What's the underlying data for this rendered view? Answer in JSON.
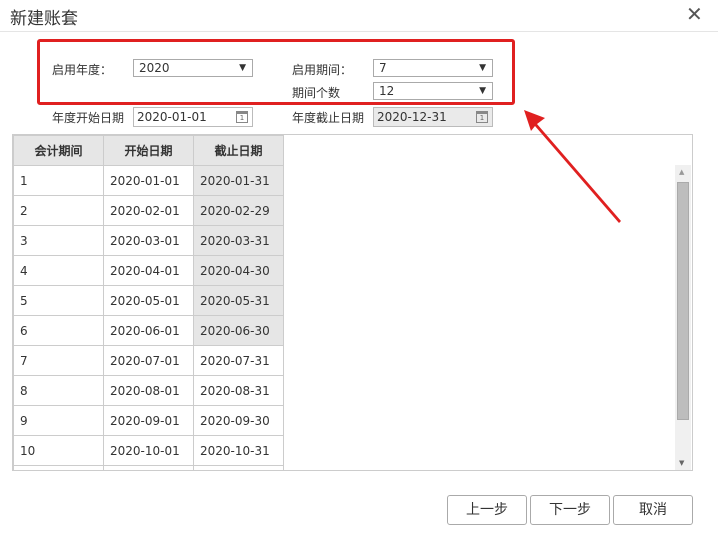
{
  "dialog": {
    "title": "新建账套",
    "close_icon": "close-icon"
  },
  "form": {
    "start_year_label": "启用年度：",
    "start_year_value": "2020",
    "start_period_label": "启用期间：",
    "start_period_value": "7",
    "period_count_label": "期间个数",
    "period_count_value": "12",
    "year_start_label": "年度开始日期",
    "year_start_value": "2020-01-01",
    "year_end_label": "年度截止日期",
    "year_end_value": "2020-12-31"
  },
  "table": {
    "headers": [
      "会计期间",
      "开始日期",
      "截止日期"
    ],
    "rows": [
      [
        "1",
        "2020-01-01",
        "2020-01-31"
      ],
      [
        "2",
        "2020-02-01",
        "2020-02-29"
      ],
      [
        "3",
        "2020-03-01",
        "2020-03-31"
      ],
      [
        "4",
        "2020-04-01",
        "2020-04-30"
      ],
      [
        "5",
        "2020-05-01",
        "2020-05-31"
      ],
      [
        "6",
        "2020-06-01",
        "2020-06-30"
      ],
      [
        "7",
        "2020-07-01",
        "2020-07-31"
      ],
      [
        "8",
        "2020-08-01",
        "2020-08-31"
      ],
      [
        "9",
        "2020-09-01",
        "2020-09-30"
      ],
      [
        "10",
        "2020-10-01",
        "2020-10-31"
      ],
      [
        "",
        "",
        ""
      ]
    ]
  },
  "buttons": {
    "prev": "上一步",
    "next": "下一步",
    "cancel": "取消"
  },
  "colors": {
    "highlight": "#e02020"
  }
}
